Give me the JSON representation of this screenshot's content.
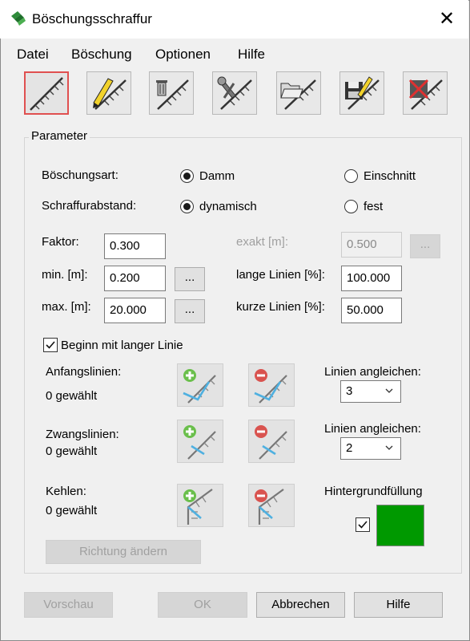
{
  "window": {
    "title": "Böschungsschraffur",
    "close_glyph": "✕"
  },
  "menu": [
    "Datei",
    "Böschung",
    "Optionen",
    "Hilfe"
  ],
  "toolbar": [
    {
      "name": "new-slope",
      "icon": "slope-hatch-icon"
    },
    {
      "name": "edit-slope",
      "icon": "pencil-slope-icon"
    },
    {
      "name": "delete-slope",
      "icon": "trash-slope-icon"
    },
    {
      "name": "settings-slope",
      "icon": "wrench-slope-icon"
    },
    {
      "name": "open-slope",
      "icon": "folder-slope-icon"
    },
    {
      "name": "save-slope",
      "icon": "save-slope-icon"
    },
    {
      "name": "remove-slope",
      "icon": "crossed-slope-icon"
    }
  ],
  "parameter": {
    "group_title": "Parameter",
    "boeschungsart_label": "Böschungsart:",
    "damm": "Damm",
    "einschnitt": "Einschnitt",
    "schraffurabstand_label": "Schraffurabstand:",
    "dynamisch": "dynamisch",
    "fest": "fest",
    "faktor_label": "Faktor:",
    "faktor_value": "0.300",
    "exakt_label": "exakt [m]:",
    "exakt_value": "0.500",
    "min_label": "min. [m]:",
    "min_value": "0.200",
    "max_label": "max. [m]:",
    "max_value": "20.000",
    "lange_label": "lange Linien [%]:",
    "lange_value": "100.000",
    "kurze_label": "kurze Linien [%]:",
    "kurze_value": "50.000",
    "dots": "...",
    "beginn_label": "Beginn mit langer Linie",
    "anfangslinien_label": "Anfangslinien:",
    "anfangslinien_count": "0 gewählt",
    "zwangslinien_label": "Zwangslinien:",
    "zwangslinien_count": "0 gewählt",
    "kehlen_label": "Kehlen:",
    "kehlen_count": "0 gewählt",
    "angleichen1_label": "Linien angleichen:",
    "angleichen1_value": "3",
    "angleichen2_label": "Linien angleichen:",
    "angleichen2_value": "2",
    "hintergrund_label": "Hintergrundfüllung",
    "hintergrund_color": "#009900",
    "richtung_label": "Richtung ändern"
  },
  "footer": {
    "vorschau": "Vorschau",
    "ok": "OK",
    "abbrechen": "Abbrechen",
    "hilfe": "Hilfe"
  }
}
